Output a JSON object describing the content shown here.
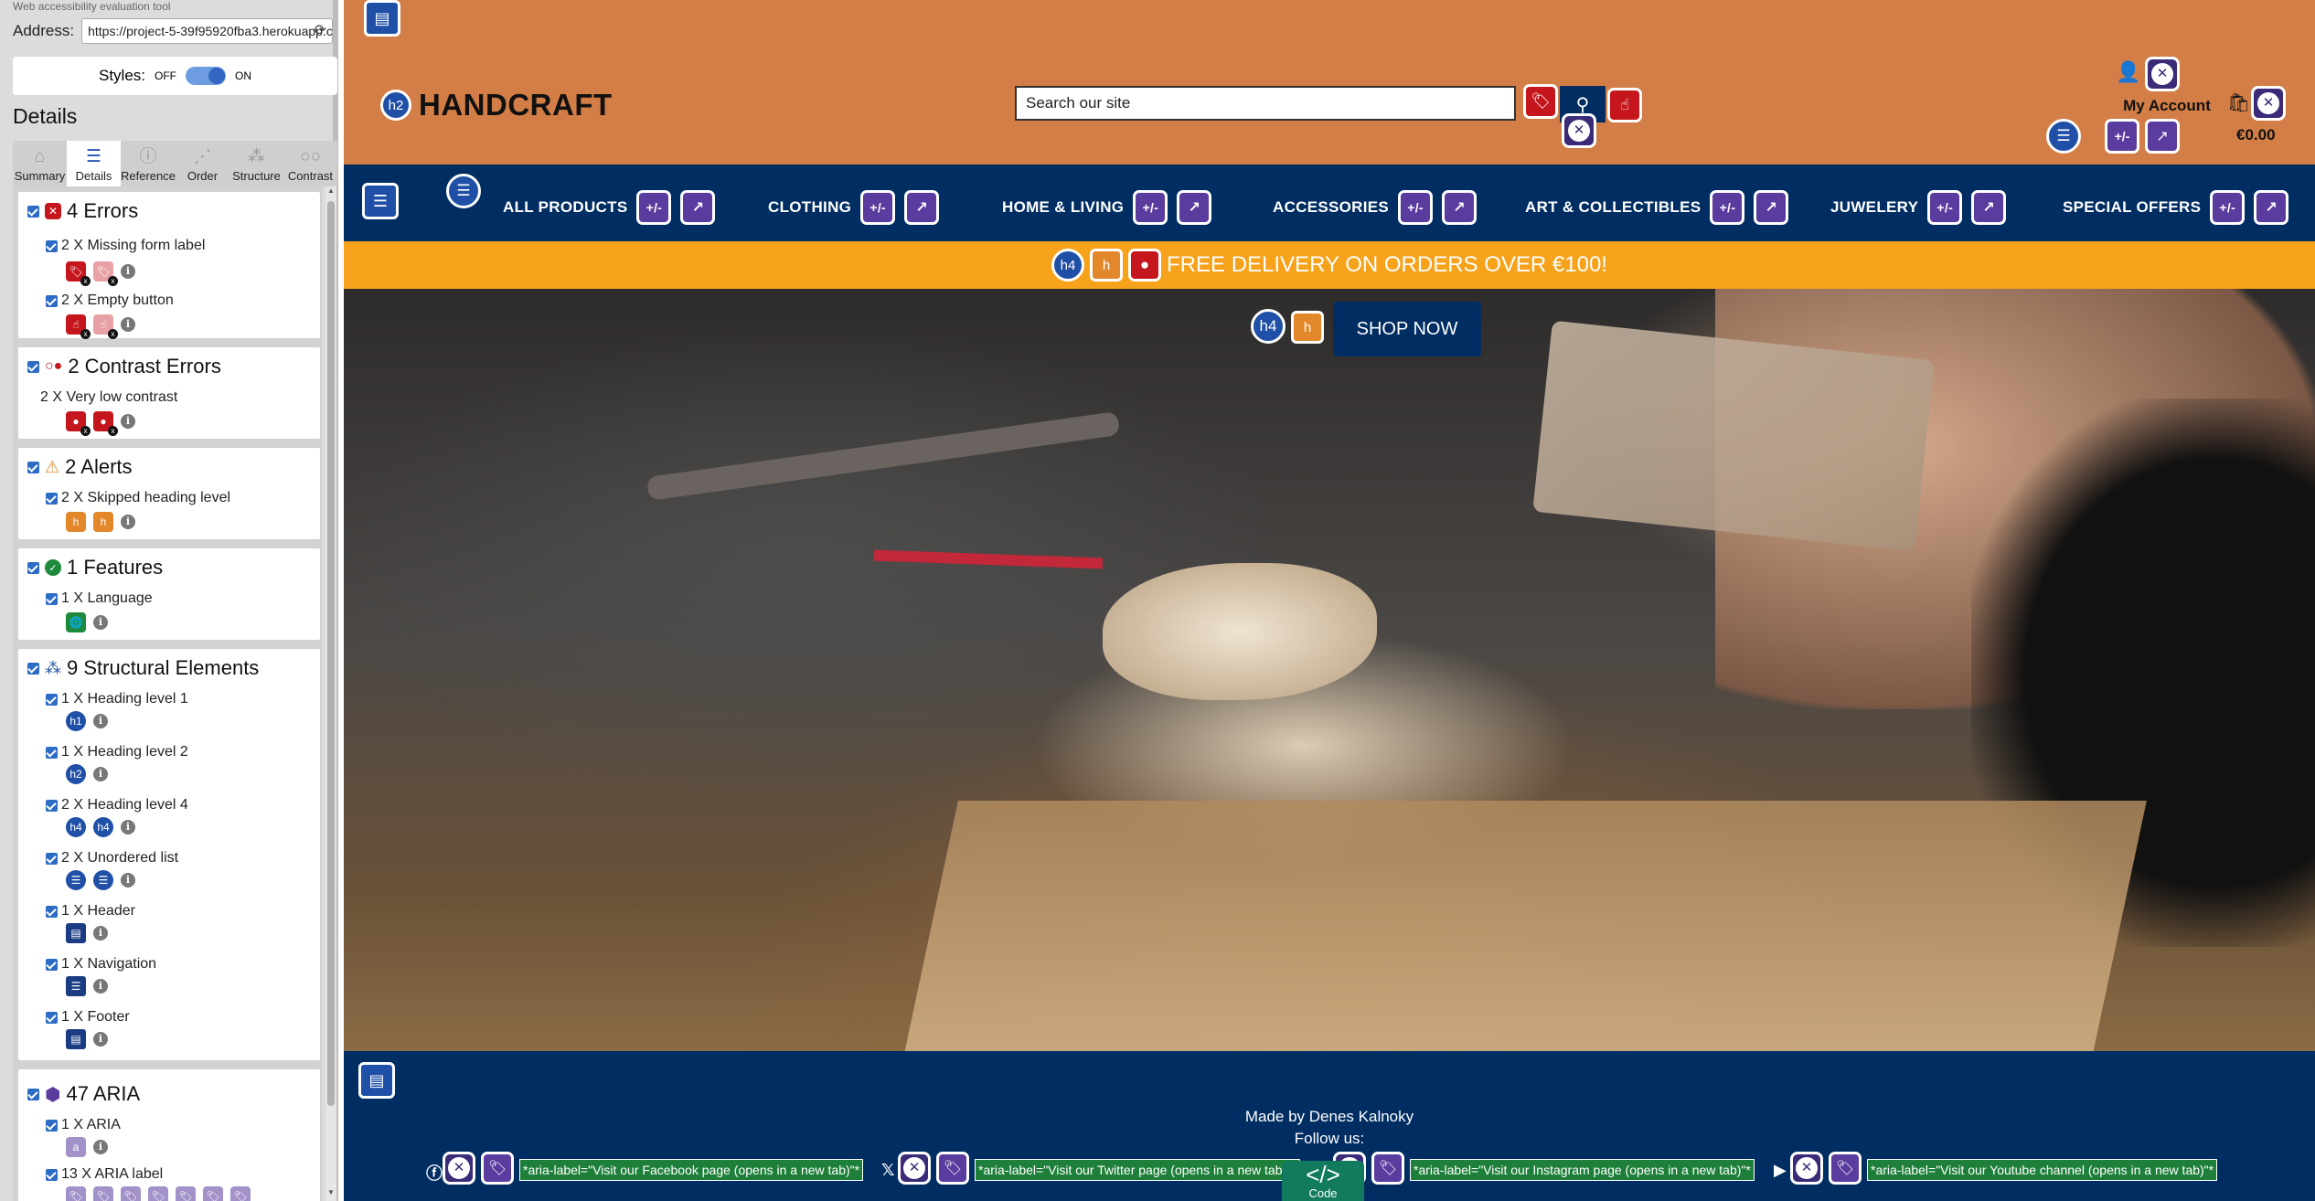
{
  "wave": {
    "topline": "Web accessibility evaluation tool",
    "address_label": "Address:",
    "address_value": "https://project-5-39f95920fba3.herokuapp.com/",
    "styles_label": "Styles:",
    "styles_off": "OFF",
    "styles_on": "ON",
    "details_heading": "Details",
    "tabs": [
      {
        "label": "Summary",
        "icon": "home-icon"
      },
      {
        "label": "Details",
        "icon": "list-icon"
      },
      {
        "label": "Reference",
        "icon": "info-icon"
      },
      {
        "label": "Order",
        "icon": "order-icon"
      },
      {
        "label": "Structure",
        "icon": "structure-icon"
      },
      {
        "label": "Contrast",
        "icon": "contrast-icon"
      }
    ],
    "sections": {
      "errors": {
        "title": "4 Errors",
        "items": [
          "2 X Missing form label",
          "2 X Empty button"
        ]
      },
      "contrast": {
        "title": "2 Contrast Errors",
        "items": [
          "2 X Very low contrast"
        ]
      },
      "alerts": {
        "title": "2 Alerts",
        "items": [
          "2 X Skipped heading level"
        ]
      },
      "features": {
        "title": "1 Features",
        "items": [
          "1 X Language"
        ]
      },
      "structure": {
        "title": "9 Structural Elements",
        "items": [
          "1 X Heading level 1",
          "1 X Heading level 2",
          "2 X Heading level 4",
          "2 X Unordered list",
          "1 X Header",
          "1 X Navigation",
          "1 X Footer"
        ]
      },
      "aria": {
        "title": "47 ARIA",
        "items": [
          "1 X ARIA",
          "13 X ARIA label"
        ]
      }
    }
  },
  "site": {
    "brand": "HANDCRAFT",
    "brand_heading_badge": "h2",
    "search_placeholder": "Search our site",
    "account_label": "My Account",
    "cart_total": "€0.00",
    "nav": [
      "ALL PRODUCTS",
      "CLOTHING",
      "HOME & LIVING",
      "ACCESSORIES",
      "ART & COLLECTIBLES",
      "JUWELERY",
      "SPECIAL OFFERS"
    ],
    "nav_badge": "+/-",
    "promo_badge": "h4",
    "promo_text": "FREE DELIVERY ON ORDERS OVER €100!",
    "shop_badge": "h4",
    "shop_now": "SHOP NOW",
    "footer_made": "Made by Denes Kalnoky",
    "footer_follow": "Follow us:",
    "aria_labels": [
      "*aria-label=\"Visit our Facebook page (opens in a new tab)\"*",
      "*aria-label=\"Visit our Twitter page (opens in a new tab)\"*",
      "*aria-label=\"Visit our Instagram page (opens in a new tab)\"*",
      "*aria-label=\"Visit our Youtube channel (opens in a new tab)\"*"
    ],
    "code_button": "</>",
    "code_label": "Code"
  },
  "colors": {
    "header": "#d37e46",
    "nav": "#002d62",
    "promo": "#f7a21b",
    "aria_green": "#1e7f3a"
  }
}
